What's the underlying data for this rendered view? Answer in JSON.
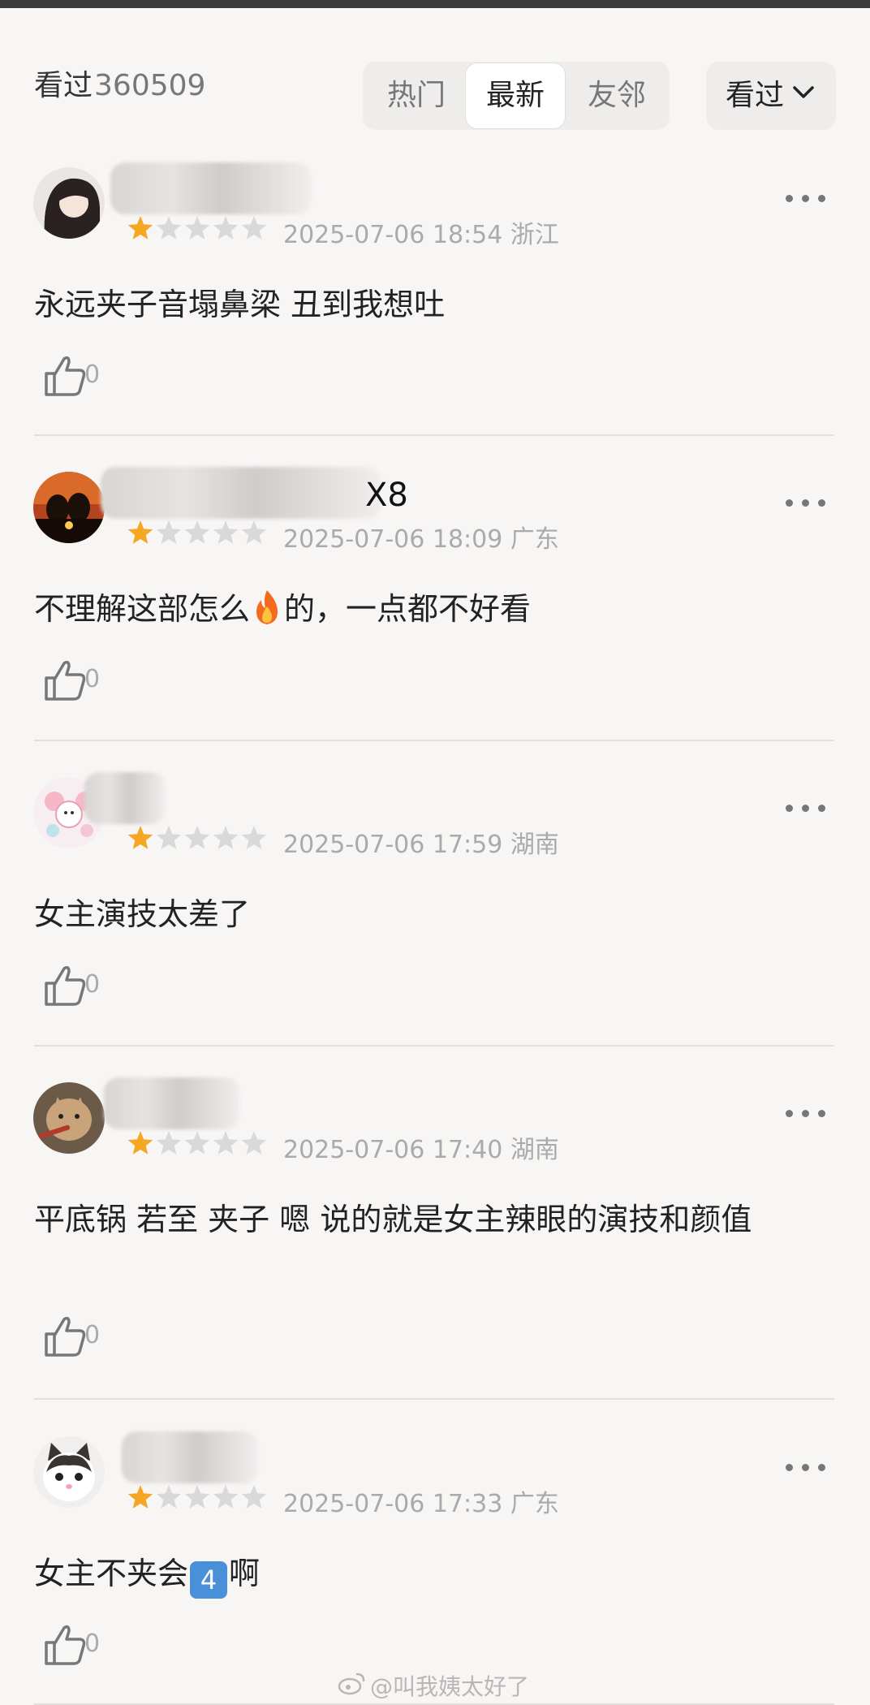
{
  "header": {
    "seen_label": "看过",
    "seen_count": "360509",
    "tabs": [
      {
        "label": "热门"
      },
      {
        "label": "最新"
      },
      {
        "label": "友邻"
      }
    ],
    "filter_label": "看过"
  },
  "reviews": [
    {
      "name": "",
      "rating": 1,
      "date": "2025-07-06 18:54",
      "location": "浙江",
      "content": "永远夹子音塌鼻梁 丑到我想吐",
      "likes": "0"
    },
    {
      "name": "X8",
      "rating": 1,
      "date": "2025-07-06 18:09",
      "location": "广东",
      "content_before": "不理解这部怎么",
      "content_after": "的，一点都不好看",
      "likes": "0"
    },
    {
      "name": "",
      "rating": 1,
      "date": "2025-07-06 17:59",
      "location": "湖南",
      "content": "女主演技太差了",
      "likes": "0"
    },
    {
      "name": "",
      "rating": 1,
      "date": "2025-07-06 17:40",
      "location": "湖南",
      "content": "平底锅 若至 夹子 嗯 说的就是女主辣眼的演技和颜值",
      "likes": "0"
    },
    {
      "name": "",
      "rating": 1,
      "date": "2025-07-06 17:33",
      "location": "广东",
      "content_before": "女主不夹会",
      "content_emoji": "4",
      "content_after": "啊",
      "likes": "0"
    }
  ],
  "watermark": "@叫我姨太好了",
  "colors": {
    "star_active": "#f5a623",
    "star_inactive": "#d9d9d9",
    "background": "#f8f6f5"
  }
}
